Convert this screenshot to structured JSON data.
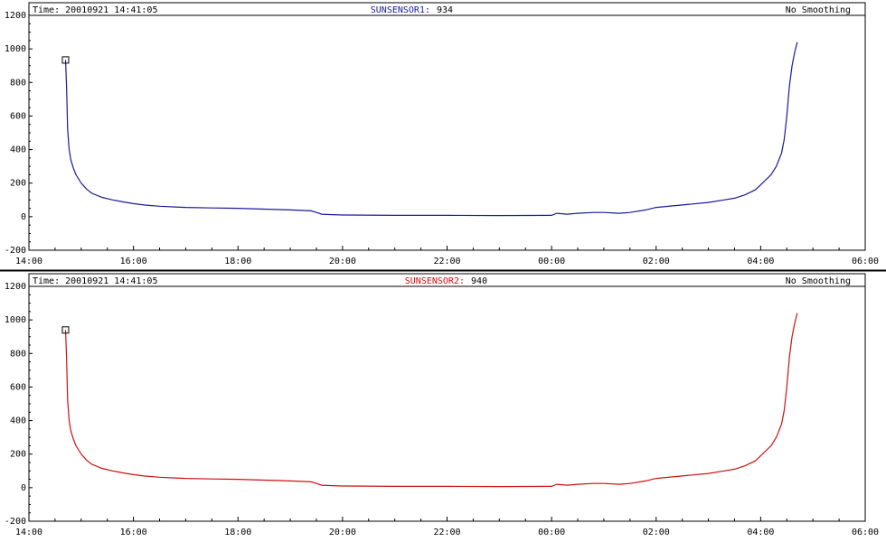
{
  "colors": {
    "panel1": "#1a1a9a",
    "panel2": "#cc1111",
    "marker": "#000000"
  },
  "chart_data": [
    {
      "type": "line",
      "time_text": "Time: 20010921 14:41:05",
      "sensor_label": "SUNSENSOR1:",
      "sensor_value": "934",
      "smoothing": "No Smoothing",
      "x_ticks": [
        "14:00",
        "16:00",
        "18:00",
        "20:00",
        "22:00",
        "00:00",
        "02:00",
        "04:00",
        "06:00"
      ],
      "y_ticks": [
        "-200",
        "0",
        "200",
        "400",
        "600",
        "800",
        "1000",
        "1200"
      ],
      "ylim": [
        -200,
        1200
      ],
      "xlim": [
        0,
        16
      ],
      "x_unit": "hours since 14:00",
      "series": [
        {
          "color": "#1a1a9a",
          "x": [
            0.7,
            0.72,
            0.74,
            0.77,
            0.8,
            0.85,
            0.9,
            1.0,
            1.1,
            1.2,
            1.4,
            1.6,
            1.8,
            2.0,
            2.2,
            2.5,
            2.8,
            3.0,
            3.5,
            4.0,
            4.5,
            5.0,
            5.4,
            5.5,
            5.6,
            5.8,
            6.0,
            7.0,
            8.0,
            9.0,
            10.0,
            10.1,
            10.3,
            10.5,
            10.8,
            11.0,
            11.3,
            11.5,
            11.8,
            12.0,
            12.5,
            13.0,
            13.3,
            13.5,
            13.7,
            13.9,
            14.0,
            14.2,
            14.3,
            14.4,
            14.45,
            14.5,
            14.55,
            14.6,
            14.65,
            14.7
          ],
          "y": [
            934,
            780,
            520,
            400,
            340,
            290,
            250,
            200,
            165,
            140,
            115,
            100,
            88,
            78,
            70,
            62,
            58,
            55,
            52,
            50,
            45,
            40,
            35,
            25,
            15,
            12,
            10,
            8,
            8,
            7,
            8,
            20,
            15,
            20,
            25,
            25,
            20,
            25,
            40,
            55,
            70,
            85,
            100,
            110,
            130,
            160,
            190,
            250,
            300,
            380,
            460,
            600,
            780,
            900,
            980,
            1040
          ]
        }
      ]
    },
    {
      "type": "line",
      "time_text": "Time: 20010921 14:41:05",
      "sensor_label": "SUNSENSOR2:",
      "sensor_value": "940",
      "smoothing": "No Smoothing",
      "x_ticks": [
        "14:00",
        "16:00",
        "18:00",
        "20:00",
        "22:00",
        "00:00",
        "02:00",
        "04:00",
        "06:00"
      ],
      "y_ticks": [
        "-200",
        "0",
        "200",
        "400",
        "600",
        "800",
        "1000",
        "1200"
      ],
      "ylim": [
        -200,
        1200
      ],
      "xlim": [
        0,
        16
      ],
      "x_unit": "hours since 14:00",
      "series": [
        {
          "color": "#cc1111",
          "x": [
            0.7,
            0.72,
            0.74,
            0.77,
            0.8,
            0.85,
            0.9,
            1.0,
            1.1,
            1.2,
            1.4,
            1.6,
            1.8,
            2.0,
            2.2,
            2.5,
            2.8,
            3.0,
            3.5,
            4.0,
            4.5,
            5.0,
            5.4,
            5.5,
            5.6,
            5.8,
            6.0,
            7.0,
            8.0,
            9.0,
            10.0,
            10.1,
            10.3,
            10.5,
            10.8,
            11.0,
            11.3,
            11.5,
            11.8,
            12.0,
            12.5,
            13.0,
            13.3,
            13.5,
            13.7,
            13.9,
            14.0,
            14.2,
            14.3,
            14.4,
            14.45,
            14.5,
            14.55,
            14.6,
            14.65,
            14.7
          ],
          "y": [
            940,
            780,
            520,
            400,
            340,
            290,
            250,
            200,
            165,
            140,
            115,
            100,
            88,
            78,
            70,
            62,
            58,
            55,
            52,
            50,
            45,
            40,
            35,
            25,
            15,
            12,
            10,
            8,
            8,
            7,
            8,
            20,
            15,
            20,
            25,
            25,
            20,
            25,
            40,
            55,
            70,
            85,
            100,
            110,
            130,
            160,
            190,
            250,
            300,
            380,
            460,
            600,
            780,
            900,
            980,
            1040
          ]
        }
      ]
    }
  ]
}
